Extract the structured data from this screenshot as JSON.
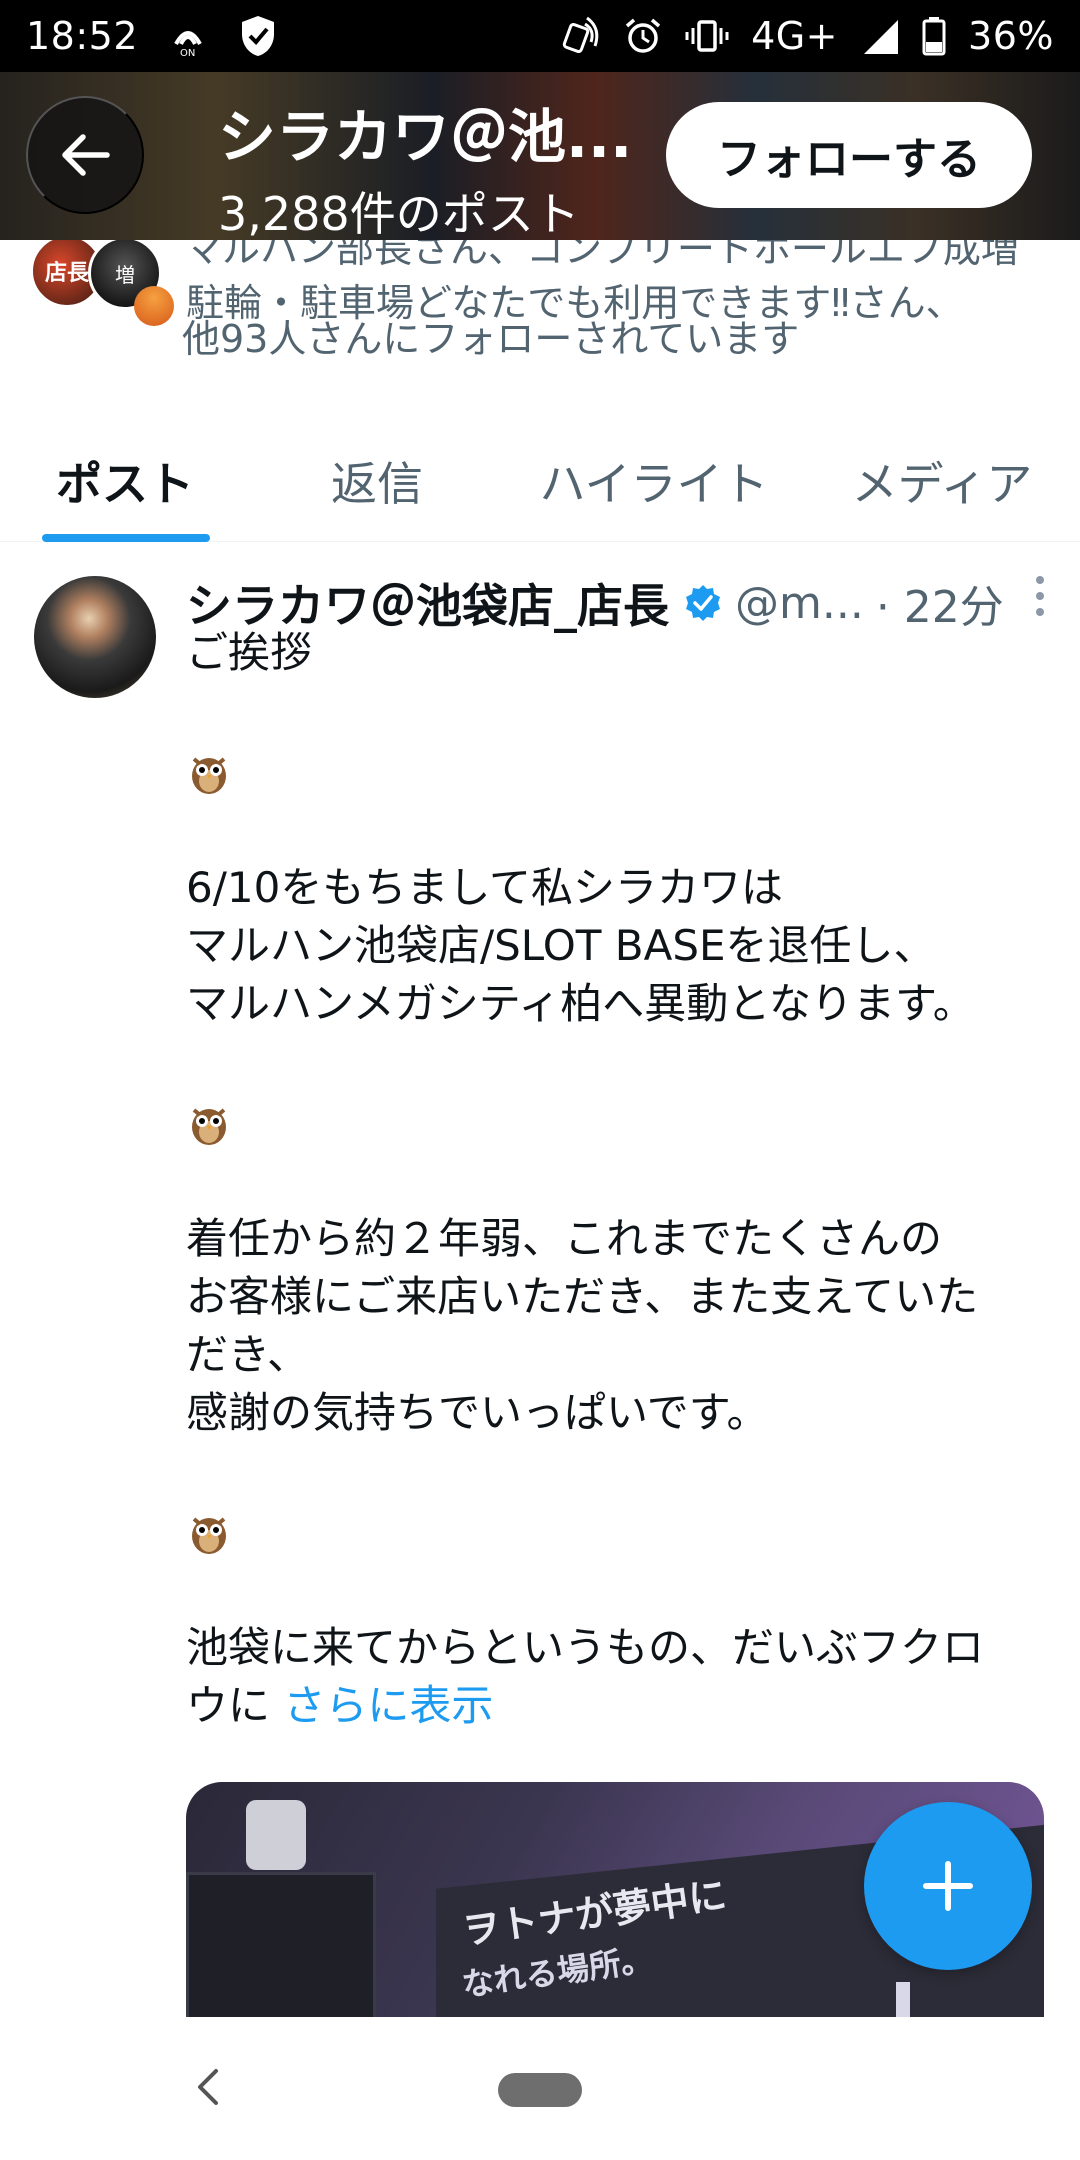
{
  "status_bar": {
    "time": "18:52",
    "network": "4G+",
    "battery": "36%",
    "icons": [
      "wifi-calling-icon",
      "shield-icon",
      "nfc-icon",
      "alarm-icon",
      "vibrate-icon",
      "signal-icon",
      "battery-icon"
    ]
  },
  "header": {
    "title": "シラカワ＠池...",
    "post_count": "3,288件のポスト",
    "follow_label": "フォローする"
  },
  "followed_by": {
    "line1": "マルハン部長さん、コンプリートホールエフ成増",
    "line2": "駐輪・駐車場どなたでも利用できます‼さん、",
    "line3": "他93人さんにフォローされています",
    "avatar1_text": "店長",
    "avatar2_text": "増"
  },
  "tabs": [
    {
      "label": "ポスト",
      "active": true
    },
    {
      "label": "返信",
      "active": false
    },
    {
      "label": "ハイライト",
      "active": false
    },
    {
      "label": "メディア",
      "active": false
    }
  ],
  "tweet": {
    "name": "シラカワ＠池袋店_店長",
    "handle": "@m...",
    "time": "· 22分",
    "lines": [
      "ご挨拶",
      "6/10をもちまして私シラカワは",
      "マルハン池袋店/SLOT BASEを退任し、",
      "マルハンメガシティ柏へ異動となります。",
      "着任から約２年弱、これまでたくさんの",
      "お客様にご来店いただき、また支えていた",
      "だき、",
      "感謝の気持ちでいっぱいです。",
      "池袋に来てからというもの、だいぶフクロ",
      "ウに"
    ],
    "show_more": "さらに表示",
    "media_text1": "ヲトナが夢中に",
    "media_text2": "なれる場所。"
  },
  "colors": {
    "accent": "#1d9bf0",
    "text_primary": "#0f1419",
    "text_secondary": "#536471"
  }
}
